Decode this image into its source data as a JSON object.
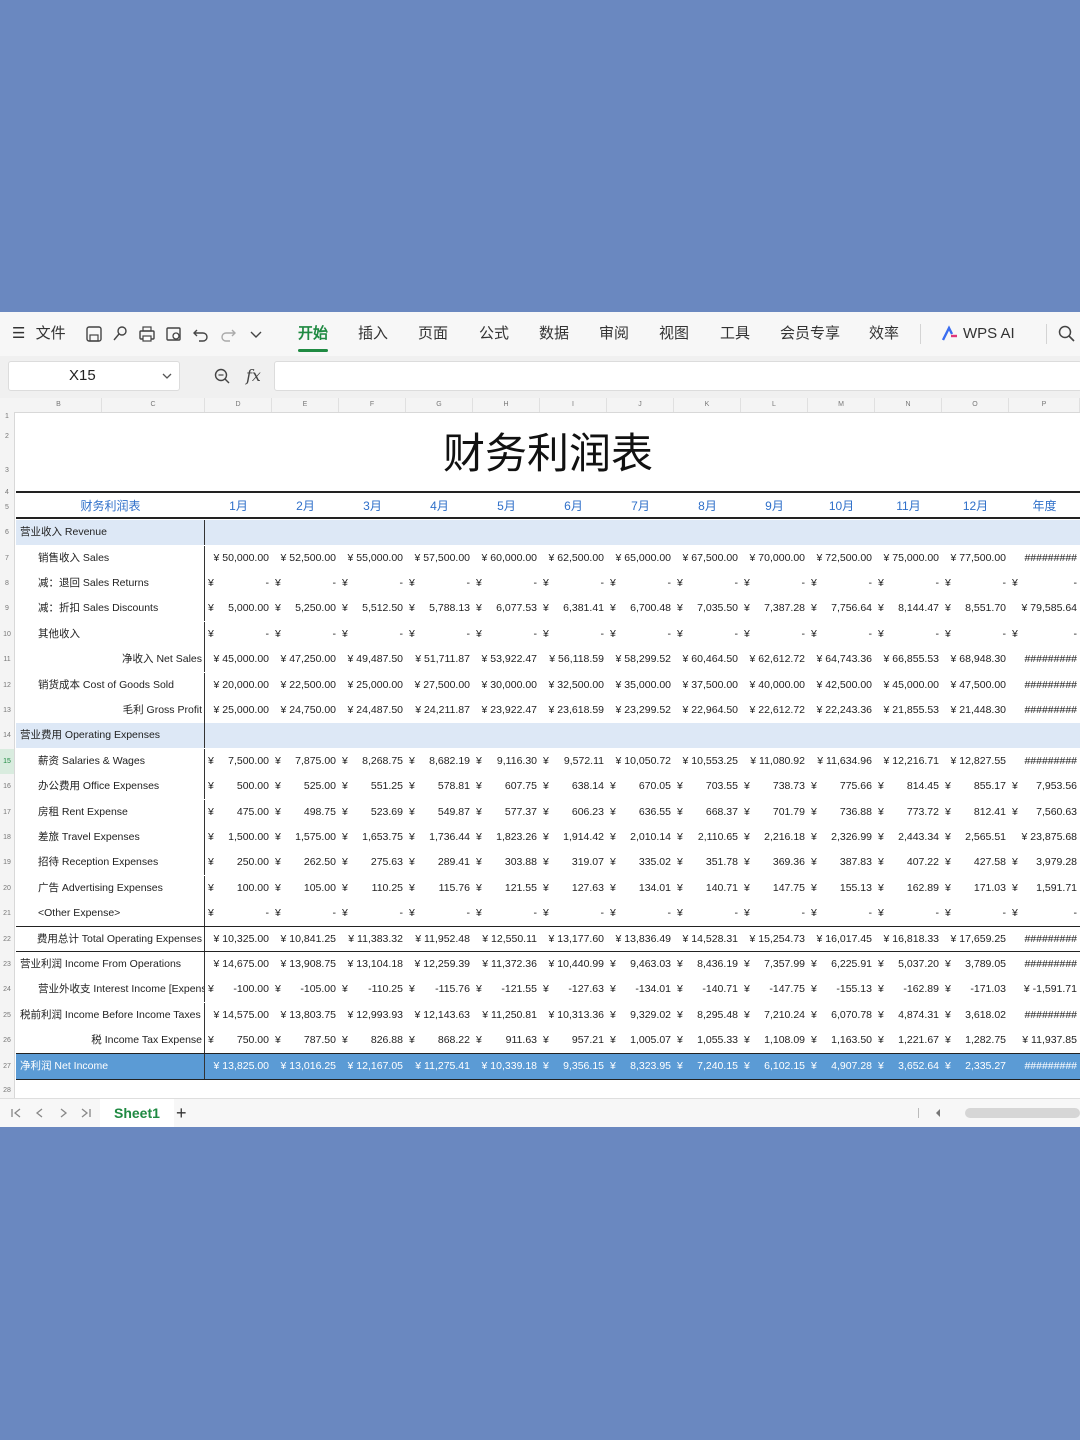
{
  "menu": {
    "file": "文件",
    "tabs": [
      "开始",
      "插入",
      "页面",
      "公式",
      "数据",
      "审阅",
      "视图",
      "工具",
      "会员专享",
      "效率"
    ],
    "active_tab": "开始",
    "wps_ai": "WPS AI"
  },
  "formula_bar": {
    "cell_ref": "X15",
    "fx_label": "fx",
    "formula": ""
  },
  "columns": [
    "B",
    "C",
    "D",
    "E",
    "F",
    "G",
    "H",
    "I",
    "J",
    "K",
    "L",
    "M",
    "N",
    "O",
    "P"
  ],
  "rows_numbers": [
    "1",
    "2",
    "3",
    "4",
    "5",
    "6",
    "7",
    "8",
    "9",
    "10",
    "11",
    "12",
    "13",
    "14",
    "15",
    "16",
    "17",
    "18",
    "19",
    "20",
    "21",
    "22",
    "23",
    "24",
    "25",
    "26",
    "27",
    "28"
  ],
  "sheet": {
    "title": "财务利润表",
    "header_label": "财务利润表",
    "months": [
      "1月",
      "2月",
      "3月",
      "4月",
      "5月",
      "6月",
      "7月",
      "8月",
      "9月",
      "10月",
      "11月",
      "12月",
      "年度"
    ],
    "currency": "¥",
    "rows": [
      {
        "label": "营业收入 Revenue",
        "style": "band",
        "values": []
      },
      {
        "label": "销售收入 Sales",
        "style": "ind1",
        "values": [
          "¥ 50,000.00",
          "¥ 52,500.00",
          "¥ 55,000.00",
          "¥ 57,500.00",
          "¥ 60,000.00",
          "¥ 62,500.00",
          "¥ 65,000.00",
          "¥ 67,500.00",
          "¥ 70,000.00",
          "¥ 72,500.00",
          "¥ 75,000.00",
          "¥ 77,500.00",
          "#########"
        ]
      },
      {
        "label": "减：退回 Sales Returns",
        "style": "ind1",
        "values": [
          "-",
          "-",
          "-",
          "-",
          "-",
          "-",
          "-",
          "-",
          "-",
          "-",
          "-",
          "-",
          "-"
        ]
      },
      {
        "label": "减：折扣 Sales Discounts",
        "style": "ind1",
        "values": [
          "5,000.00",
          "5,250.00",
          "5,512.50",
          "5,788.13",
          "6,077.53",
          "6,381.41",
          "6,700.48",
          "7,035.50",
          "7,387.28",
          "7,756.64",
          "8,144.47",
          "8,551.70",
          "¥ 79,585.64"
        ]
      },
      {
        "label": "其他收入",
        "style": "ind1",
        "values": [
          "-",
          "-",
          "-",
          "-",
          "-",
          "-",
          "-",
          "-",
          "-",
          "-",
          "-",
          "-",
          "-"
        ]
      },
      {
        "label": "净收入 Net Sales",
        "style": "right",
        "values": [
          "¥ 45,000.00",
          "¥ 47,250.00",
          "¥ 49,487.50",
          "¥ 51,711.87",
          "¥ 53,922.47",
          "¥ 56,118.59",
          "¥ 58,299.52",
          "¥ 60,464.50",
          "¥ 62,612.72",
          "¥ 64,743.36",
          "¥ 66,855.53",
          "¥ 68,948.30",
          "#########"
        ]
      },
      {
        "label": "销货成本 Cost of Goods Sold",
        "style": "ind1",
        "values": [
          "¥ 20,000.00",
          "¥ 22,500.00",
          "¥ 25,000.00",
          "¥ 27,500.00",
          "¥ 30,000.00",
          "¥ 32,500.00",
          "¥ 35,000.00",
          "¥ 37,500.00",
          "¥ 40,000.00",
          "¥ 42,500.00",
          "¥ 45,000.00",
          "¥ 47,500.00",
          "#########"
        ]
      },
      {
        "label": "毛利 Gross Profit",
        "style": "right",
        "values": [
          "¥ 25,000.00",
          "¥ 24,750.00",
          "¥ 24,487.50",
          "¥ 24,211.87",
          "¥ 23,922.47",
          "¥ 23,618.59",
          "¥ 23,299.52",
          "¥ 22,964.50",
          "¥ 22,612.72",
          "¥ 22,243.36",
          "¥ 21,855.53",
          "¥ 21,448.30",
          "#########"
        ]
      },
      {
        "label": "营业费用 Operating Expenses",
        "style": "band",
        "values": []
      },
      {
        "label": "薪资 Salaries & Wages",
        "style": "ind1",
        "values": [
          "7,500.00",
          "7,875.00",
          "8,268.75",
          "8,682.19",
          "9,116.30",
          "9,572.11",
          "¥ 10,050.72",
          "¥ 10,553.25",
          "¥ 11,080.92",
          "¥ 11,634.96",
          "¥ 12,216.71",
          "¥ 12,827.55",
          "#########"
        ]
      },
      {
        "label": "办公费用 Office Expenses",
        "style": "ind1",
        "values": [
          "500.00",
          "525.00",
          "551.25",
          "578.81",
          "607.75",
          "638.14",
          "670.05",
          "703.55",
          "738.73",
          "775.66",
          "814.45",
          "855.17",
          "7,953.56"
        ]
      },
      {
        "label": "房租 Rent Expense",
        "style": "ind1",
        "values": [
          "475.00",
          "498.75",
          "523.69",
          "549.87",
          "577.37",
          "606.23",
          "636.55",
          "668.37",
          "701.79",
          "736.88",
          "773.72",
          "812.41",
          "7,560.63"
        ]
      },
      {
        "label": "差旅 Travel Expenses",
        "style": "ind1",
        "values": [
          "1,500.00",
          "1,575.00",
          "1,653.75",
          "1,736.44",
          "1,823.26",
          "1,914.42",
          "2,010.14",
          "2,110.65",
          "2,216.18",
          "2,326.99",
          "2,443.34",
          "2,565.51",
          "¥ 23,875.68"
        ]
      },
      {
        "label": "招待 Reception Expenses",
        "style": "ind1",
        "values": [
          "250.00",
          "262.50",
          "275.63",
          "289.41",
          "303.88",
          "319.07",
          "335.02",
          "351.78",
          "369.36",
          "387.83",
          "407.22",
          "427.58",
          "3,979.28"
        ]
      },
      {
        "label": "广告 Advertising Expenses",
        "style": "ind1",
        "values": [
          "100.00",
          "105.00",
          "110.25",
          "115.76",
          "121.55",
          "127.63",
          "134.01",
          "140.71",
          "147.75",
          "155.13",
          "162.89",
          "171.03",
          "1,591.71"
        ]
      },
      {
        "label": "<Other Expense>",
        "style": "ind1",
        "values": [
          "-",
          "-",
          "-",
          "-",
          "-",
          "-",
          "-",
          "-",
          "-",
          "-",
          "-",
          "-",
          "-"
        ]
      },
      {
        "label": "费用总计 Total Operating Expenses",
        "style": "right",
        "values": [
          "¥ 10,325.00",
          "¥ 10,841.25",
          "¥ 11,383.32",
          "¥ 11,952.48",
          "¥ 12,550.11",
          "¥ 13,177.60",
          "¥ 13,836.49",
          "¥ 14,528.31",
          "¥ 15,254.73",
          "¥ 16,017.45",
          "¥ 16,818.33",
          "¥ 17,659.25",
          "#########"
        ]
      },
      {
        "label": "营业利润 Income From Operations",
        "style": "plain",
        "values": [
          "¥ 14,675.00",
          "¥ 13,908.75",
          "¥ 13,104.18",
          "¥ 12,259.39",
          "¥ 11,372.36",
          "¥ 10,440.99",
          "9,463.03",
          "8,436.19",
          "7,357.99",
          "6,225.91",
          "5,037.20",
          "3,789.05",
          "#########"
        ]
      },
      {
        "label": "营业外收支 Interest Income [Expense]",
        "style": "ind1",
        "values": [
          "-100.00",
          "-105.00",
          "-110.25",
          "-115.76",
          "-121.55",
          "-127.63",
          "-134.01",
          "-140.71",
          "-147.75",
          "-155.13",
          "-162.89",
          "-171.03",
          "¥ -1,591.71"
        ]
      },
      {
        "label": "税前利润 Income Before Income Taxes",
        "style": "plain",
        "values": [
          "¥ 14,575.00",
          "¥ 13,803.75",
          "¥ 12,993.93",
          "¥ 12,143.63",
          "¥ 11,250.81",
          "¥ 10,313.36",
          "9,329.02",
          "8,295.48",
          "7,210.24",
          "6,070.78",
          "4,874.31",
          "3,618.02",
          "#########"
        ]
      },
      {
        "label": "税 Income Tax Expense",
        "style": "right",
        "values": [
          "750.00",
          "787.50",
          "826.88",
          "868.22",
          "911.63",
          "957.21",
          "1,005.07",
          "1,055.33",
          "1,108.09",
          "1,163.50",
          "1,221.67",
          "1,282.75",
          "¥ 11,937.85"
        ]
      },
      {
        "label": "净利润 Net Income",
        "style": "net",
        "values": [
          "¥ 13,825.00",
          "¥ 13,016.25",
          "¥ 12,167.05",
          "¥ 11,275.41",
          "¥ 10,339.18",
          "9,356.15",
          "8,323.95",
          "7,240.15",
          "6,102.15",
          "4,907.28",
          "3,652.64",
          "2,335.27",
          "#########"
        ]
      }
    ]
  },
  "sheet_tabs": {
    "active": "Sheet1",
    "add": "+"
  }
}
